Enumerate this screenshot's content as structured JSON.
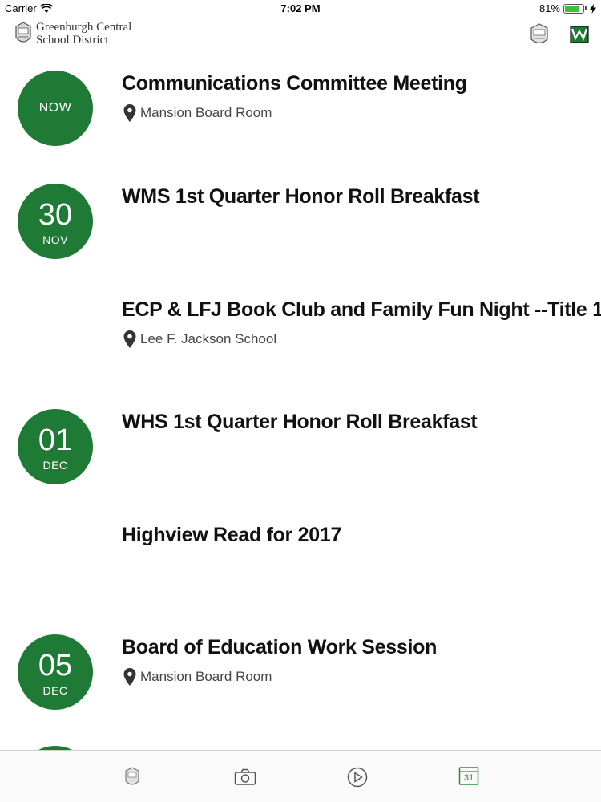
{
  "status_bar": {
    "carrier": "Carrier",
    "time": "7:02 PM",
    "battery_pct": "81%",
    "battery_level": 0.81
  },
  "header": {
    "logo_line1": "Greenburgh Central",
    "logo_line2": "School District",
    "crest_text": "GCSD",
    "icons": [
      "gcsd-crest-icon",
      "school-emblem-icon"
    ]
  },
  "events": [
    {
      "title": "Communications Committee Meeting",
      "location": "Mansion Board Room",
      "badge_now": "NOW"
    },
    {
      "title": "WMS 1st Quarter Honor Roll Breakfast",
      "badge_day": "30",
      "badge_month": "NOV"
    },
    {
      "title": "ECP & LFJ Book Club and Family Fun Night --Title 1",
      "location": "Lee F. Jackson School"
    },
    {
      "title": "WHS 1st Quarter Honor Roll Breakfast",
      "badge_day": "01",
      "badge_month": "DEC"
    },
    {
      "title": "Highview Read for 2017"
    },
    {
      "title": "Board of Education Work Session",
      "location": "Mansion Board Room",
      "badge_day": "05",
      "badge_month": "DEC"
    }
  ],
  "tab_bar": {
    "tabs": [
      "home-crest-icon",
      "camera-icon",
      "play-icon",
      "calendar-icon"
    ],
    "calendar_number": "31",
    "active_color": "#2e8b47"
  },
  "colors": {
    "badge": "#1f7a35",
    "accent": "#2e8b47"
  }
}
